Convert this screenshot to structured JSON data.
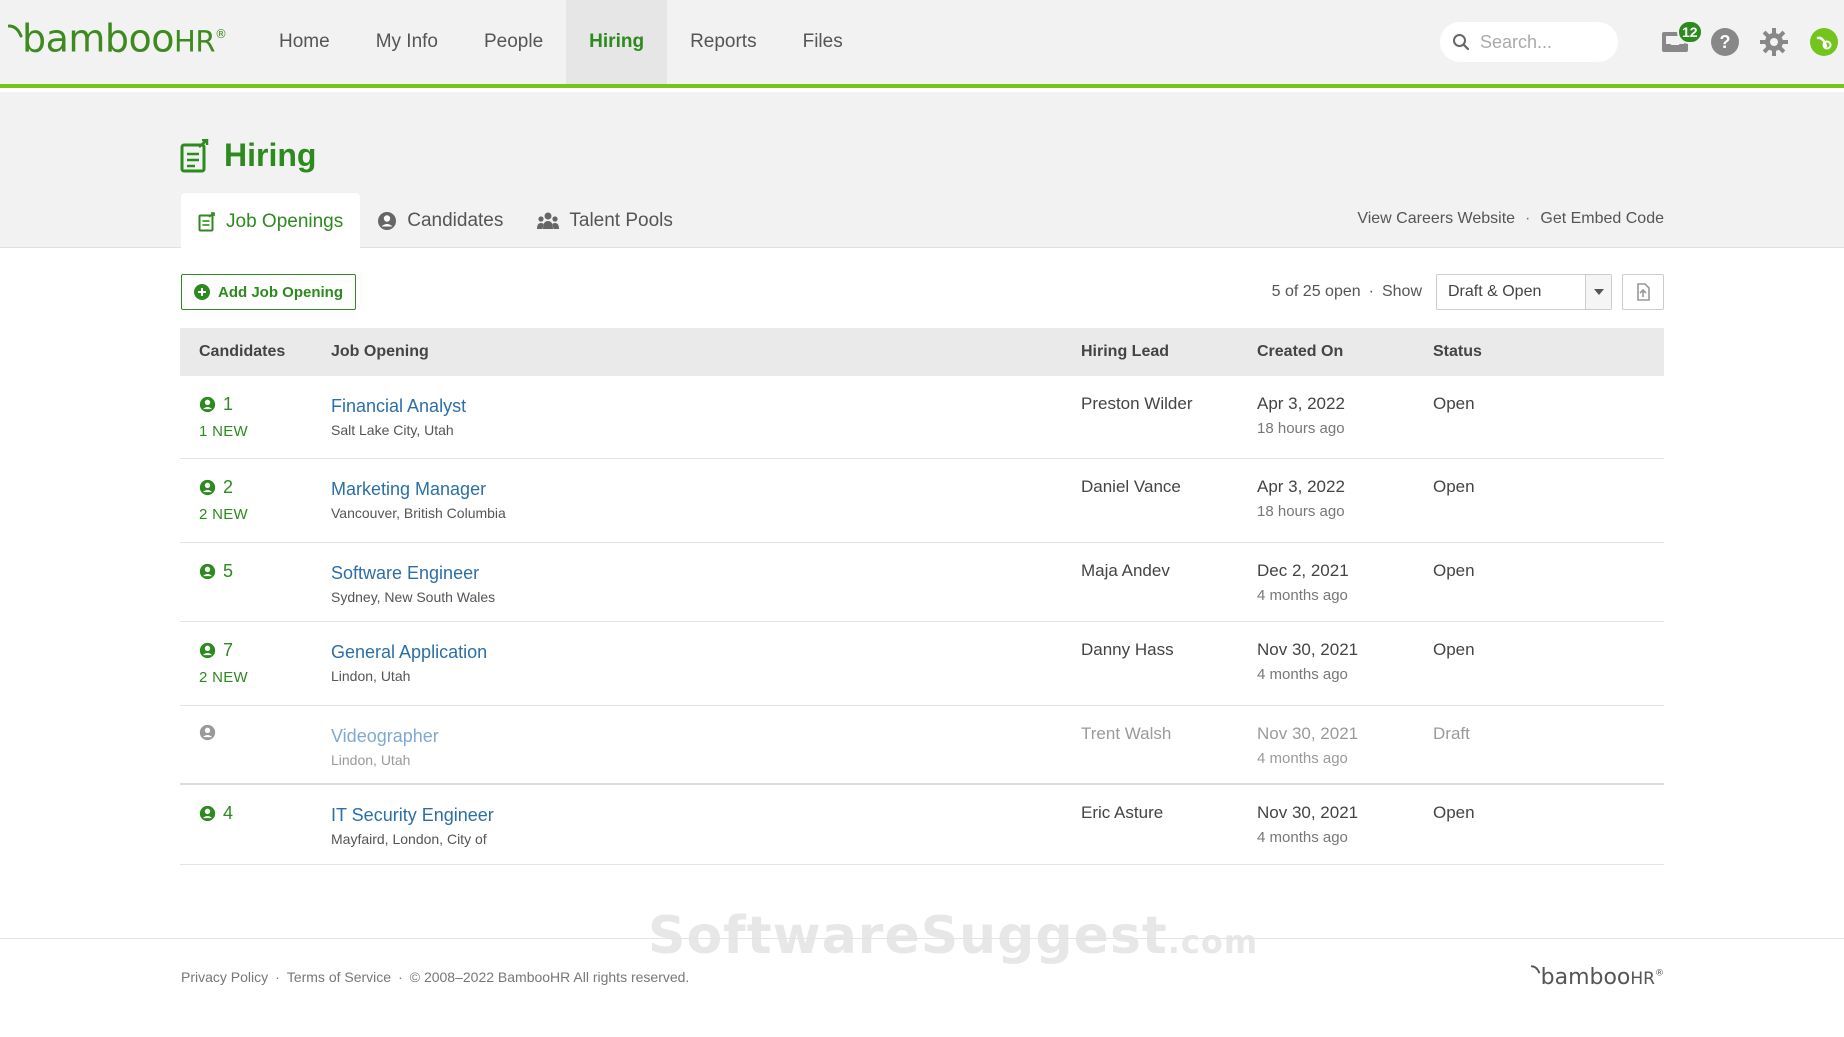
{
  "brand": {
    "logo_text": "bamboo",
    "logo_hr": "HR",
    "logo_reg": "®",
    "accent": "#73c41d",
    "primary": "#2d8a1e"
  },
  "nav": {
    "items": [
      {
        "label": "Home"
      },
      {
        "label": "My Info"
      },
      {
        "label": "People"
      },
      {
        "label": "Hiring",
        "active": true
      },
      {
        "label": "Reports"
      },
      {
        "label": "Files"
      }
    ],
    "search_placeholder": "Search...",
    "notification_count": "12"
  },
  "page": {
    "title": "Hiring",
    "tabs": [
      {
        "label": "Job Openings",
        "icon": "job-openings-icon",
        "active": true
      },
      {
        "label": "Candidates",
        "icon": "person-icon"
      },
      {
        "label": "Talent Pools",
        "icon": "group-icon"
      }
    ],
    "view_careers": "View Careers Website",
    "embed_code": "Get Embed Code",
    "link_sep": "·"
  },
  "toolbar": {
    "add_label": "Add Job Opening",
    "open_count": "5 of 25 open",
    "dot": "·",
    "show_label": "Show",
    "filter_value": "Draft & Open"
  },
  "table": {
    "headers": {
      "candidates": "Candidates",
      "job_opening": "Job Opening",
      "hiring_lead": "Hiring Lead",
      "created_on": "Created On",
      "status": "Status"
    },
    "rows": [
      {
        "count": "1",
        "new": "1 NEW",
        "title": "Financial Analyst",
        "location": "Salt Lake City, Utah",
        "lead": "Preston Wilder",
        "date": "Apr 3, 2022",
        "ago": "18 hours ago",
        "status": "Open"
      },
      {
        "count": "2",
        "new": "2 NEW",
        "title": "Marketing Manager",
        "location": "Vancouver, British Columbia",
        "lead": "Daniel Vance",
        "date": "Apr 3, 2022",
        "ago": "18 hours ago",
        "status": "Open"
      },
      {
        "count": "5",
        "new": "",
        "title": "Software Engineer",
        "location": "Sydney, New South Wales",
        "lead": "Maja Andev",
        "date": "Dec 2, 2021",
        "ago": "4 months ago",
        "status": "Open"
      },
      {
        "count": "7",
        "new": "2 NEW",
        "title": "General Application",
        "location": "Lindon, Utah",
        "lead": "Danny Hass",
        "date": "Nov 30, 2021",
        "ago": "4 months ago",
        "status": "Open"
      },
      {
        "count": "",
        "new": "",
        "title": "Videographer",
        "location": "Lindon, Utah",
        "lead": "Trent Walsh",
        "date": "Nov 30, 2021",
        "ago": "4 months ago",
        "status": "Draft"
      },
      {
        "count": "4",
        "new": "",
        "title": "IT Security Engineer",
        "location": "Mayfaird, London, City of",
        "lead": "Eric Asture",
        "date": "Nov 30, 2021",
        "ago": "4 months ago",
        "status": "Open"
      }
    ]
  },
  "footer": {
    "privacy": "Privacy Policy",
    "terms": "Terms of Service",
    "sep": "·",
    "copyright": "© 2008–2022 BambooHR All rights reserved.",
    "logo_text": "bamboo",
    "logo_hr": "HR",
    "logo_reg": "®"
  },
  "watermark": {
    "main": "SoftwareSuggest",
    "suffix": ".com"
  }
}
